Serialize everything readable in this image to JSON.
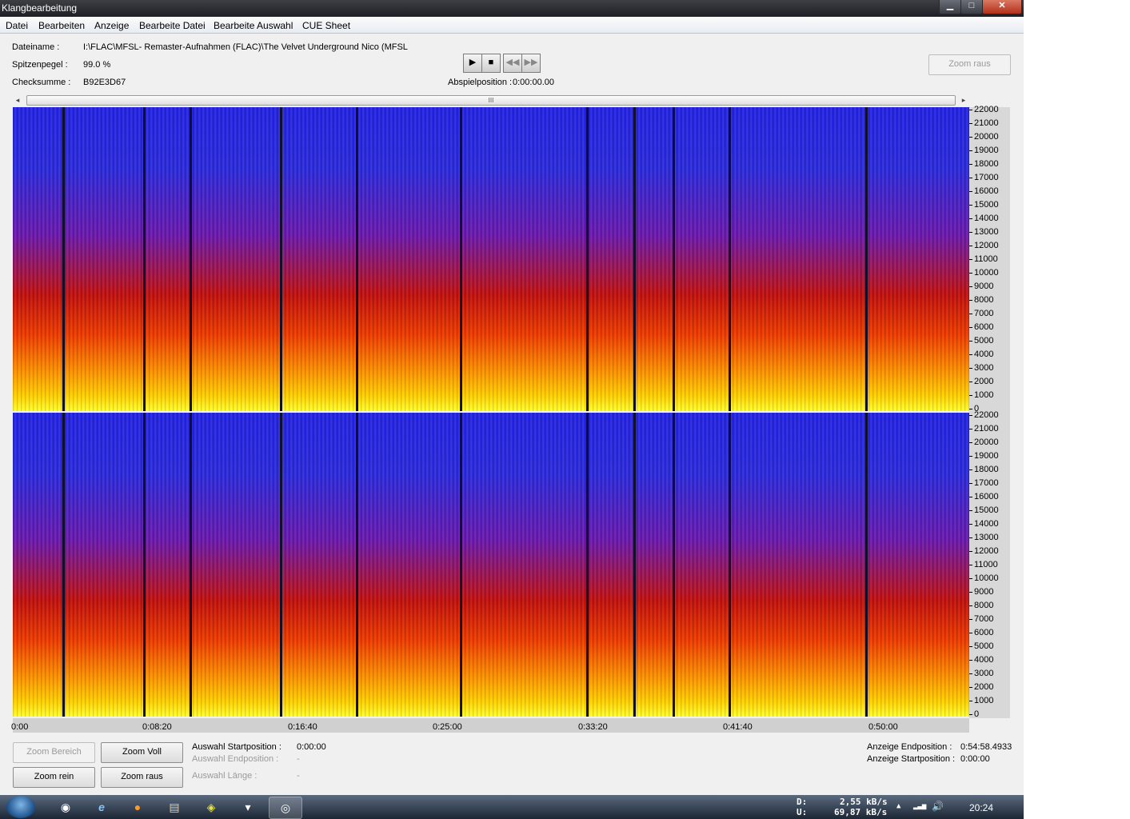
{
  "window": {
    "title": "Klangbearbeitung",
    "min": "▁",
    "max": "□",
    "close": "✕"
  },
  "menu": [
    "Datei",
    "Bearbeiten",
    "Anzeige",
    "Bearbeite Datei",
    "Bearbeite Auswahl",
    "CUE Sheet"
  ],
  "info": {
    "filename_label": "Dateiname :",
    "filename_value": "I:\\FLAC\\MFSL- Remaster-Aufnahmen (FLAC)\\The Velvet Underground  Nico (MFSL",
    "peak_label": "Spitzenpegel :",
    "peak_value": "99.0 %",
    "checksum_label": "Checksumme :",
    "checksum_value": "B92E3D67",
    "playpos_label": "Abspielposition :",
    "playpos_value": "0:00:00.00"
  },
  "transport": {
    "play": "▶",
    "stop": "■",
    "rewind": "◀◀",
    "forward": "▶▶"
  },
  "zoom_raus_top": "Zoom raus",
  "scroll": {
    "left": "◂",
    "right": "▸",
    "grip": "III"
  },
  "freq_ticks": [
    "22000",
    "21000",
    "20000",
    "19000",
    "18000",
    "17000",
    "16000",
    "15000",
    "14000",
    "13000",
    "12000",
    "11000",
    "10000",
    "9000",
    "8000",
    "7000",
    "6000",
    "5000",
    "4000",
    "3000",
    "2000",
    "1000",
    "0"
  ],
  "time_ticks": [
    "0:00",
    "0:08:20",
    "0:16:40",
    "0:25:00",
    "0:33:20",
    "0:41:40",
    "0:50:00"
  ],
  "buttons": {
    "zoom_bereich": "Zoom Bereich",
    "zoom_voll": "Zoom Voll",
    "zoom_rein": "Zoom rein",
    "zoom_raus": "Zoom raus"
  },
  "selection": {
    "start_label": "Auswahl Startposition :",
    "start_value": "0:00:00",
    "end_label": "Auswahl Endposition :",
    "end_value": "-",
    "length_label": "Auswahl Länge :",
    "length_value": "-"
  },
  "display": {
    "end_label": "Anzeige Endposition :",
    "end_value": "0:54:58.4933",
    "start_label": "Anzeige Startposition :",
    "start_value": "0:00:00"
  },
  "taskbar": {
    "d_label": "D:",
    "d_value": "2,55 kB/s",
    "u_label": "U:",
    "u_value": "69,87 kB/s",
    "clock": "20:24",
    "tray_arrow": "▲",
    "tray_signal": "▂▃▅",
    "tray_volume": "🔊"
  },
  "colors": {
    "spec_low": "#2323e8",
    "spec_mid": "#c2100e",
    "spec_high": "#ffff30"
  }
}
